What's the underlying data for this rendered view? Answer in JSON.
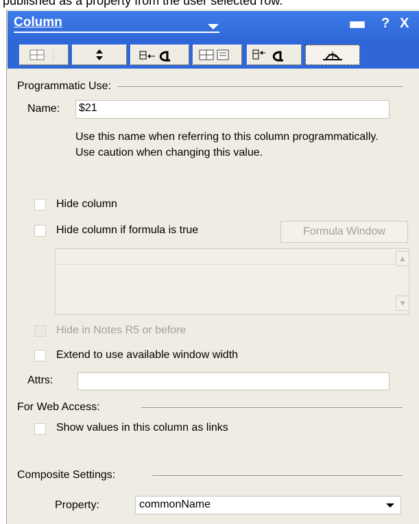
{
  "caption": "published as a property from the user selected row.",
  "window": {
    "title": "Column",
    "icons": [
      "minimize-bar-icon",
      "help-icon",
      "close-icon"
    ],
    "help_label": "?",
    "close_label": "X"
  },
  "tabs": [
    {
      "name": "column-info-tab-icon"
    },
    {
      "name": "sorting-tab-icon"
    },
    {
      "name": "column-font-tab-icon"
    },
    {
      "name": "numbers-tab-icon"
    },
    {
      "name": "title-font-tab-icon"
    },
    {
      "name": "advanced-tab-icon",
      "selected": true
    }
  ],
  "programmatic": {
    "section_label": "Programmatic Use:",
    "name_label": "Name:",
    "name_value": "$21",
    "description": "Use this name when referring to this column programmatically.  Use caution when changing this value."
  },
  "options": {
    "hide_column": "Hide column",
    "hide_if_formula": "Hide column if formula is true",
    "formula_window": "Formula Window",
    "hide_r5": "Hide in Notes R5 or before",
    "extend": "Extend to use available window width",
    "attrs_label": "Attrs:"
  },
  "web": {
    "section_label": "For Web Access:",
    "show_links": "Show values in this column as links"
  },
  "composite": {
    "section_label": "Composite Settings:",
    "property_label": "Property:",
    "property_value": "commonName"
  },
  "colors": {
    "titlebar": "#2f67d8",
    "panel": "#efece3",
    "disabled_text": "#a4a195"
  }
}
